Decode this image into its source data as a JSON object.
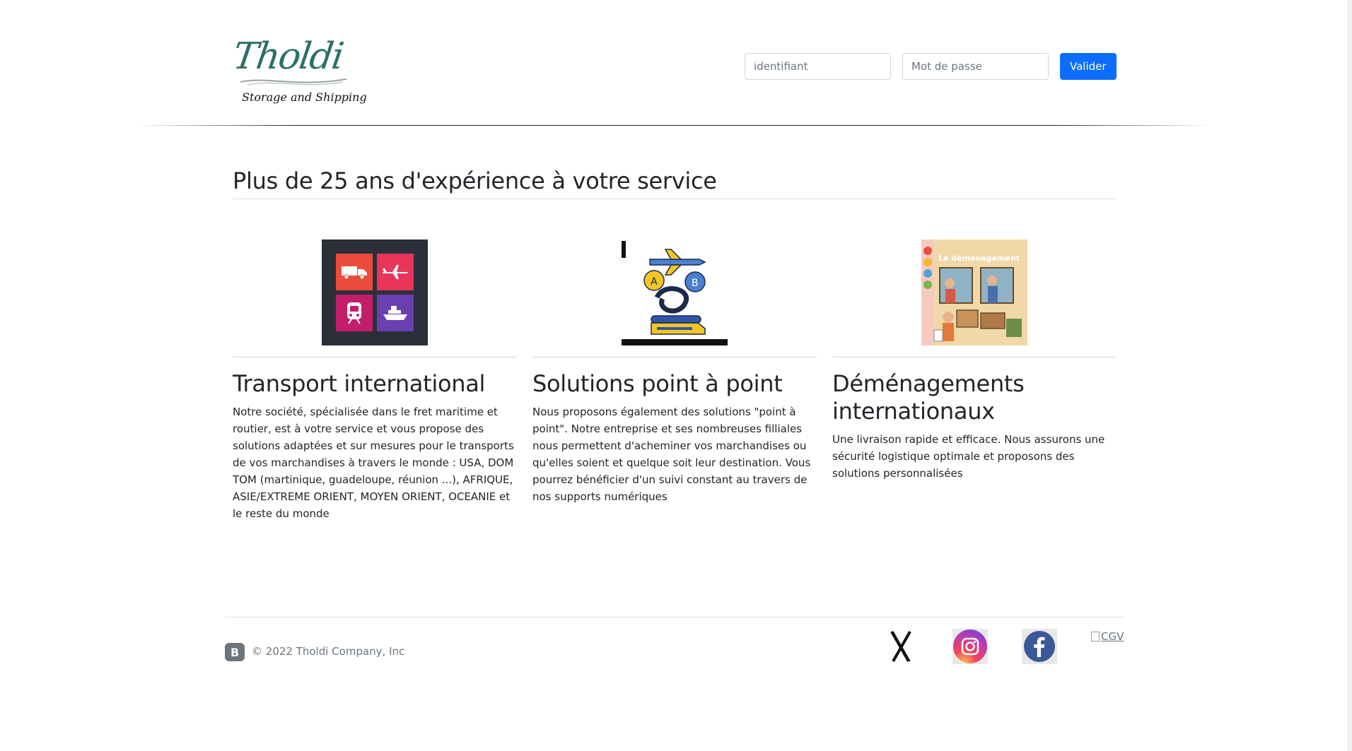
{
  "header": {
    "logo_text": "Tholdi",
    "logo_tagline": "Storage and Shipping",
    "login": {
      "username_placeholder": "identifiant",
      "password_placeholder": "Mot de passe",
      "submit_label": "Valider"
    }
  },
  "main": {
    "title": "Plus de 25 ans d'expérience à votre service",
    "cards": [
      {
        "image": "transport-modes-icon",
        "title": "Transport international",
        "text": "Notre société, spécialisée dans le fret maritime et routier, est à votre service et vous propose des solutions adaptées et sur mesures pour le transports de vos marchandises à travers le monde : USA, DOM TOM (martinique, guadeloupe, réunion ...), AFRIQUE, ASIE/EXTREME ORIENT, MOYEN ORIENT, OCEANIE et le reste du monde"
      },
      {
        "image": "point-to-point-illustration",
        "title": "Solutions point à point",
        "text": "Nous proposons également des solutions \"point à point\". Notre entreprise et ses nombreuses filliales nous permettent d'acheminer vos marchandises ou qu'elles soient et quelque soit leur destination. Vous pourrez bénéficier d'un suivi constant au travers de nos supports numériques"
      },
      {
        "image": "moving-book-cover",
        "image_caption": "Le déménagement",
        "title": "Déménagements internationaux",
        "text": "Une livraison rapide et efficace. Nous assurons une sécurité logistique optimale et proposons des solutions personnalisées"
      }
    ]
  },
  "footer": {
    "brand_letter": "B",
    "copyright": "© 2022 Tholdi Company, Inc",
    "social": [
      "x-icon",
      "instagram-icon",
      "facebook-icon"
    ],
    "cgv_alt": "CGV"
  },
  "colors": {
    "primary": "#0d6efd",
    "logo_green": "#2b7066",
    "text": "#212529",
    "muted": "#6c757d"
  }
}
